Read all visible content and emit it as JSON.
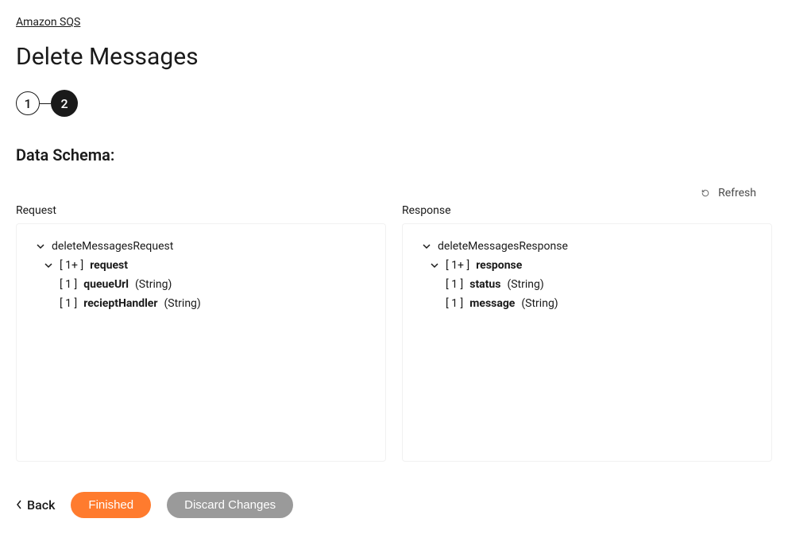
{
  "breadcrumb": {
    "label": "Amazon SQS"
  },
  "page": {
    "title": "Delete Messages"
  },
  "stepper": {
    "step1": "1",
    "step2": "2"
  },
  "section": {
    "title": "Data Schema:"
  },
  "refresh": {
    "label": "Refresh"
  },
  "requestPanel": {
    "label": "Request",
    "root": {
      "name": "deleteMessagesRequest"
    },
    "group": {
      "cardinality": "[ 1+ ]",
      "name": "request"
    },
    "fields": [
      {
        "cardinality": "[ 1 ]",
        "name": "queueUrl",
        "type": "(String)"
      },
      {
        "cardinality": "[ 1 ]",
        "name": "recieptHandler",
        "type": "(String)"
      }
    ]
  },
  "responsePanel": {
    "label": "Response",
    "root": {
      "name": "deleteMessagesResponse"
    },
    "group": {
      "cardinality": "[ 1+ ]",
      "name": "response"
    },
    "fields": [
      {
        "cardinality": "[ 1 ]",
        "name": "status",
        "type": "(String)"
      },
      {
        "cardinality": "[ 1 ]",
        "name": "message",
        "type": "(String)"
      }
    ]
  },
  "footer": {
    "back": "Back",
    "finished": "Finished",
    "discard": "Discard Changes"
  }
}
